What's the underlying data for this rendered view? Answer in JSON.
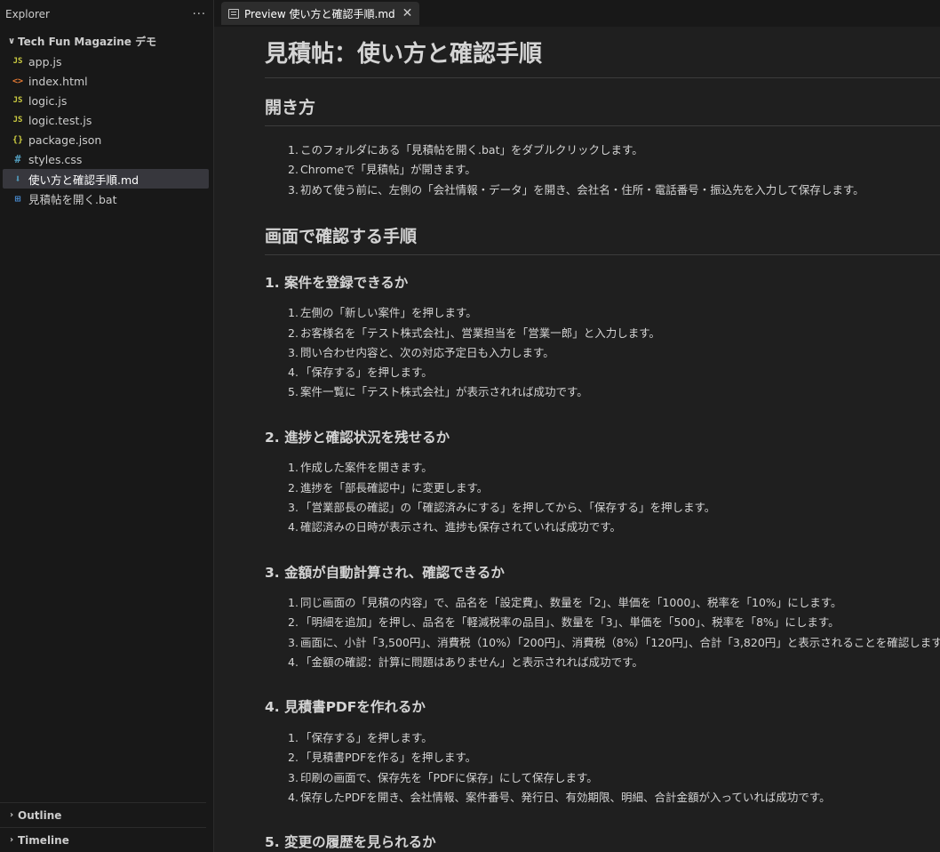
{
  "sidebar": {
    "title": "Explorer",
    "more": "···",
    "folder": "Tech Fun Magazine デモ",
    "files": [
      {
        "name": "app.js",
        "type": "js",
        "glyph": "JS",
        "icon": "js-file-icon"
      },
      {
        "name": "index.html",
        "type": "html",
        "glyph": "<>",
        "icon": "html-file-icon"
      },
      {
        "name": "logic.js",
        "type": "js",
        "glyph": "JS",
        "icon": "js-file-icon"
      },
      {
        "name": "logic.test.js",
        "type": "js",
        "glyph": "JS",
        "icon": "js-file-icon"
      },
      {
        "name": "package.json",
        "type": "json",
        "glyph": "{}",
        "icon": "json-file-icon"
      },
      {
        "name": "styles.css",
        "type": "css",
        "glyph": "#",
        "icon": "css-file-icon"
      },
      {
        "name": "使い方と確認手順.md",
        "type": "md",
        "glyph": "⬇",
        "icon": "markdown-file-icon",
        "active": true
      },
      {
        "name": "見積帖を開く.bat",
        "type": "bat",
        "glyph": "⊞",
        "icon": "windows-bat-file-icon"
      }
    ],
    "sections": [
      "Outline",
      "Timeline"
    ]
  },
  "tab": {
    "label": "Preview 使い方と確認手順.md",
    "close": "✕"
  },
  "doc": {
    "title": "見積帖：使い方と確認手順",
    "sections": [
      {
        "heading": "開き方",
        "level": 2,
        "steps": [
          "このフォルダにある「見積帖を開く.bat」をダブルクリックします。",
          "Chromeで「見積帖」が開きます。",
          "初めて使う前に、左側の「会社情報・データ」を開き、会社名・住所・電話番号・振込先を入力して保存します。"
        ]
      },
      {
        "heading": "画面で確認する手順",
        "level": 2,
        "steps": []
      },
      {
        "heading": "1. 案件を登録できるか",
        "level": 3,
        "steps": [
          "左側の「新しい案件」を押します。",
          "お客様名を「テスト株式会社」、営業担当を「営業一郎」と入力します。",
          "問い合わせ内容と、次の対応予定日も入力します。",
          "「保存する」を押します。",
          "案件一覧に「テスト株式会社」が表示されれば成功です。"
        ]
      },
      {
        "heading": "2. 進捗と確認状況を残せるか",
        "level": 3,
        "steps": [
          "作成した案件を開きます。",
          "進捗を「部長確認中」に変更します。",
          "「営業部長の確認」の「確認済みにする」を押してから、「保存する」を押します。",
          "確認済みの日時が表示され、進捗も保存されていれば成功です。"
        ]
      },
      {
        "heading": "3. 金額が自動計算され、確認できるか",
        "level": 3,
        "steps": [
          "同じ画面の「見積の内容」で、品名を「設定費」、数量を「2」、単価を「1000」、税率を「10%」にします。",
          "「明細を追加」を押し、品名を「軽減税率の品目」、数量を「3」、単価を「500」、税率を「8%」にします。",
          "画面に、小計「3,500円」、消費税（10%）「200円」、消費税（8%）「120円」、合計「3,820円」と表示されることを確認します。",
          "「金額の確認：計算に問題はありません」と表示されれば成功です。"
        ]
      },
      {
        "heading": "4. 見積書PDFを作れるか",
        "level": 3,
        "steps": [
          "「保存する」を押します。",
          "「見積書PDFを作る」を押します。",
          "印刷の画面で、保存先を「PDFに保存」にして保存します。",
          "保存したPDFを開き、会社情報、案件番号、発行日、有効期限、明細、合計金額が入っていれば成功です。"
        ]
      },
      {
        "heading": "5. 変更の履歴を見られるか",
        "level": 3,
        "steps": []
      }
    ]
  }
}
